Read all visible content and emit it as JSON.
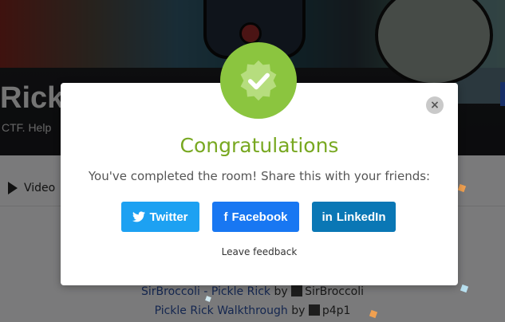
{
  "room": {
    "title": "Rick",
    "subtitle": "CTF. Help"
  },
  "tabs": {
    "video_label": "Video"
  },
  "writeups": [
    {
      "title": "SirBroccoli - Pickle Rick",
      "by": "by",
      "author": "SirBroccoli"
    },
    {
      "title": "Pickle Rick Walkthrough",
      "by": "by",
      "author": "p4p1"
    }
  ],
  "modal": {
    "title": "Congratulations",
    "message": "You've completed the room! Share this with your friends:",
    "close_label": "×",
    "twitter_label": "Twitter",
    "facebook_label": "Facebook",
    "linkedin_label": "LinkedIn",
    "twitter_icon": "twitter-icon",
    "facebook_icon_glyph": "f",
    "linkedin_icon_glyph": "in",
    "feedback_label": "Leave feedback"
  },
  "colors": {
    "accent_green": "#78a821",
    "badge_green": "#8bc53f",
    "twitter": "#1da1f2",
    "facebook": "#1877f2",
    "linkedin": "#0a77b5"
  }
}
